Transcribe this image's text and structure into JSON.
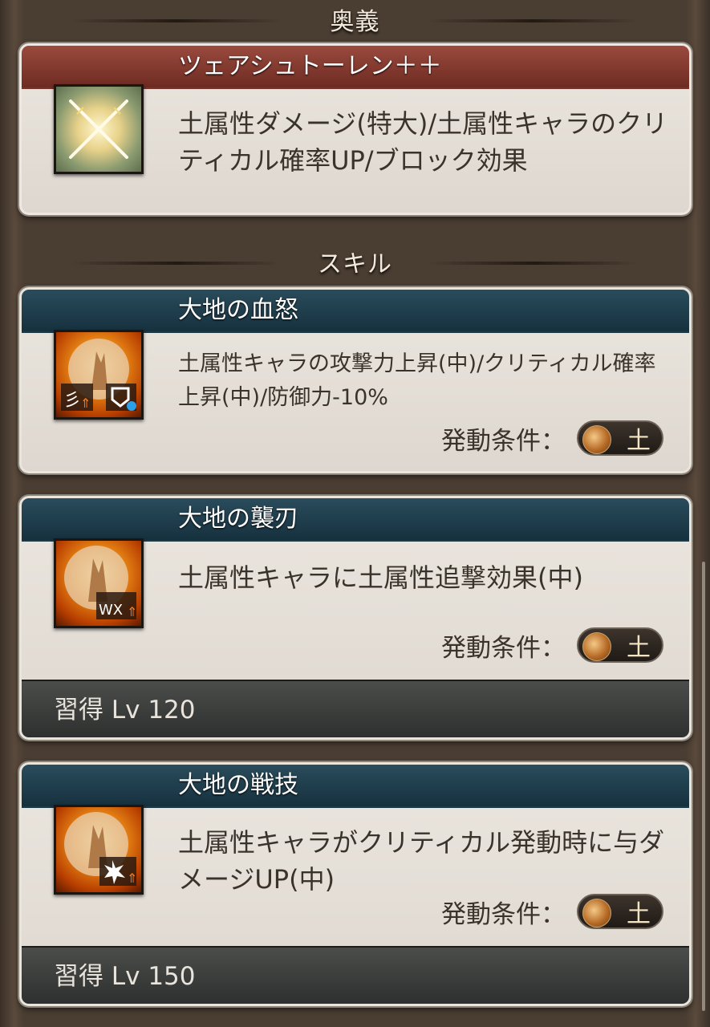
{
  "sections": {
    "ougi_header": "奥義",
    "skill_header": "スキル"
  },
  "ougi": {
    "name": "ツェアシュトーレン＋＋",
    "description": "土属性ダメージ(特大)/土属性キャラのクリティカル確率UP/ブロック効果",
    "icon": "crossed-swords-icon"
  },
  "skills": [
    {
      "name": "大地の血怒",
      "description": "土属性キャラの攻撃力上昇(中)/クリティカル確率上昇(中)/防御力-10%",
      "condition_label": "発動条件：",
      "condition_value": "土",
      "icon": "earth-attack-up-icon"
    },
    {
      "name": "大地の襲刃",
      "description": "土属性キャラに土属性追撃効果(中)",
      "condition_label": "発動条件：",
      "condition_value": "土",
      "learn": "習得 Lv 120",
      "icon": "earth-echo-icon"
    },
    {
      "name": "大地の戦技",
      "description": "土属性キャラがクリティカル発動時に与ダメージUP(中)",
      "condition_label": "発動条件：",
      "condition_value": "土",
      "learn": "習得 Lv 150",
      "icon": "earth-critical-icon"
    }
  ],
  "colors": {
    "ougi_title_bar": "#7e342a",
    "skill_title_bar": "#1e3d4b",
    "card_bg": "#e6e1da",
    "icon_orange": "#e07b12"
  }
}
